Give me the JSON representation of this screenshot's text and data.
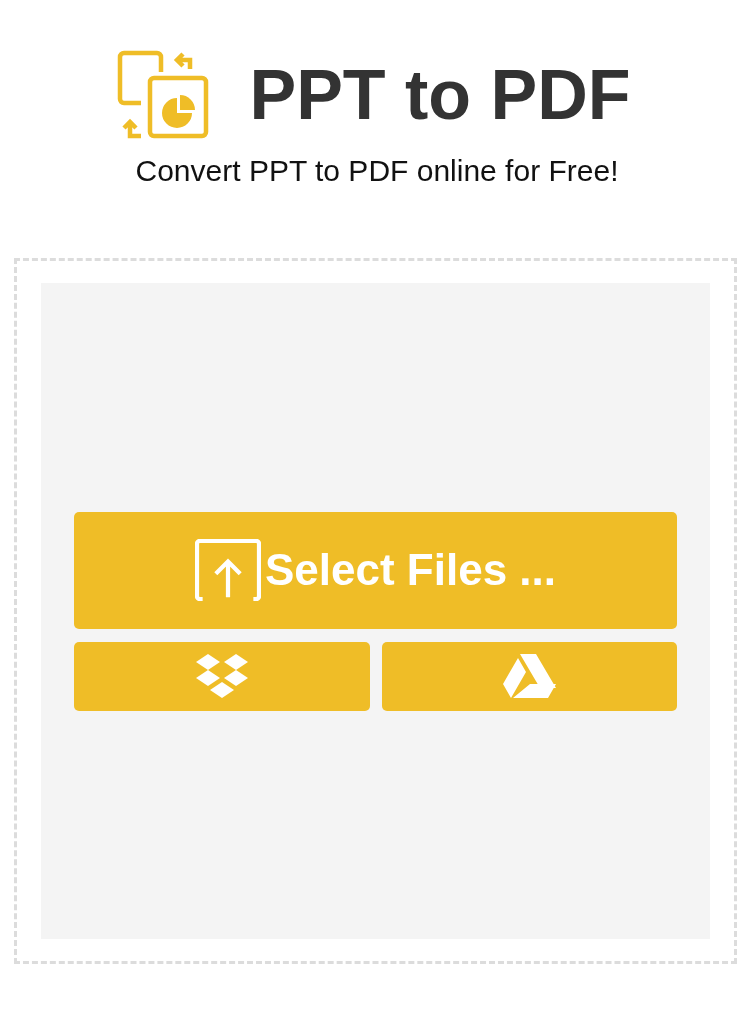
{
  "header": {
    "title": "PPT to PDF",
    "subtitle": "Convert PPT to PDF online for Free!"
  },
  "upload": {
    "select_button": "Select Files ...",
    "cloud_buttons": [
      {
        "kind": "dropbox"
      },
      {
        "kind": "drive"
      }
    ]
  }
}
